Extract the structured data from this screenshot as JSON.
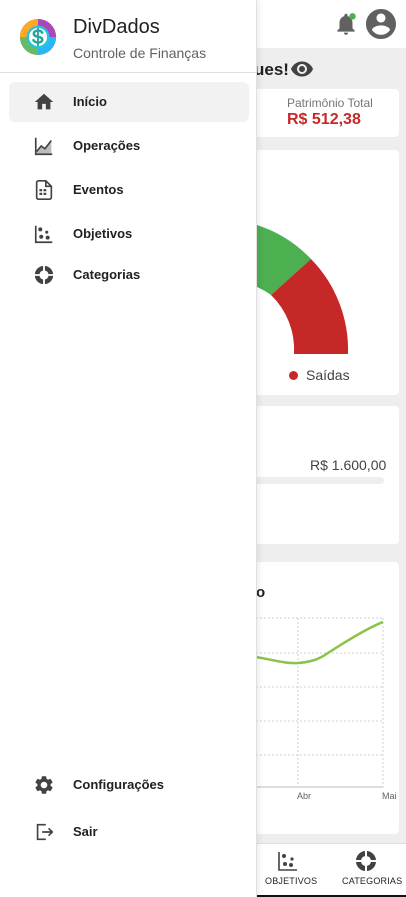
{
  "drawer": {
    "app_name": "DivDados",
    "app_subtitle": "Controle de Finanças",
    "items": [
      {
        "label": "Início",
        "icon": "home-icon",
        "active": true
      },
      {
        "label": "Operações",
        "icon": "chart-line-icon"
      },
      {
        "label": "Eventos",
        "icon": "calendar-icon"
      },
      {
        "label": "Objetivos",
        "icon": "objectives-icon"
      },
      {
        "label": "Categorias",
        "icon": "categories-icon"
      }
    ],
    "footer_items": [
      {
        "label": "Configurações",
        "icon": "gear-icon"
      },
      {
        "label": "Sair",
        "icon": "logout-icon"
      }
    ]
  },
  "background": {
    "greeting_tail": "ues!",
    "patrimonio": {
      "label": "Patrimônio Total",
      "value": "R$ 512,38"
    },
    "gauge_legend": "Saídas",
    "goal_value": "R$ 1.600,00",
    "chart_title_tail": "o",
    "chart_ticks": [
      "Abr",
      "Mai"
    ],
    "bottom_nav": [
      {
        "label": "OBJETIVOS",
        "icon": "objectives-icon"
      },
      {
        "label": "CATEGORIAS",
        "icon": "categories-icon"
      }
    ]
  },
  "colors": {
    "accent_green": "#4caf50",
    "accent_red": "#c62828",
    "line_green": "#8bc34a"
  }
}
